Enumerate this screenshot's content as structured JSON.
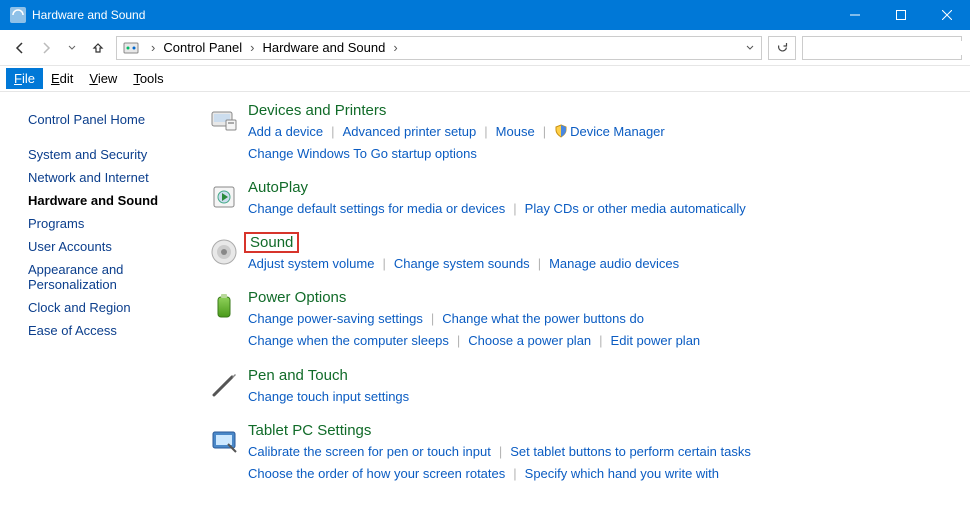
{
  "window": {
    "title": "Hardware and Sound"
  },
  "breadcrumb": {
    "root": "Control Panel",
    "current": "Hardware and Sound"
  },
  "menubar": {
    "file": "File",
    "edit": "Edit",
    "view": "View",
    "tools": "Tools"
  },
  "sidebar": {
    "home": "Control Panel Home",
    "items": [
      "System and Security",
      "Network and Internet",
      "Hardware and Sound",
      "Programs",
      "User Accounts",
      "Appearance and Personalization",
      "Clock and Region",
      "Ease of Access"
    ],
    "current_index": 2
  },
  "categories": [
    {
      "id": "devices",
      "title": "Devices and Printers",
      "tasks": [
        "Add a device",
        "Advanced printer setup",
        "Mouse",
        "Device Manager",
        "Change Windows To Go startup options"
      ],
      "shield_indices": [
        3
      ],
      "wrap_after": 3,
      "highlight": false
    },
    {
      "id": "autoplay",
      "title": "AutoPlay",
      "tasks": [
        "Change default settings for media or devices",
        "Play CDs or other media automatically"
      ],
      "shield_indices": [],
      "highlight": false
    },
    {
      "id": "sound",
      "title": "Sound",
      "tasks": [
        "Adjust system volume",
        "Change system sounds",
        "Manage audio devices"
      ],
      "shield_indices": [],
      "highlight": true
    },
    {
      "id": "power",
      "title": "Power Options",
      "tasks": [
        "Change power-saving settings",
        "Change what the power buttons do",
        "Change when the computer sleeps",
        "Choose a power plan",
        "Edit power plan"
      ],
      "shield_indices": [],
      "wrap_after": 1,
      "highlight": false
    },
    {
      "id": "pen",
      "title": "Pen and Touch",
      "tasks": [
        "Change touch input settings"
      ],
      "shield_indices": [],
      "highlight": false
    },
    {
      "id": "tablet",
      "title": "Tablet PC Settings",
      "tasks": [
        "Calibrate the screen for pen or touch input",
        "Set tablet buttons to perform certain tasks",
        "Choose the order of how your screen rotates",
        "Specify which hand you write with"
      ],
      "shield_indices": [],
      "wrap_after": 1,
      "highlight": false
    }
  ]
}
